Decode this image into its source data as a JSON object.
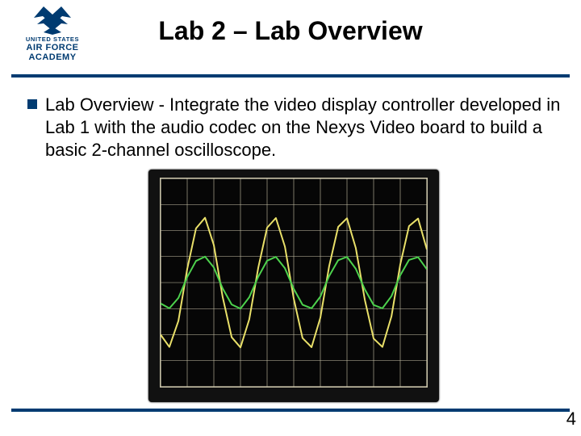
{
  "logo": {
    "line1": "UNITED STATES",
    "line2": "AIR FORCE",
    "line3": "ACADEMY"
  },
  "title": "Lab 2 – Lab Overview",
  "body": {
    "bullet1": "Lab Overview - Integrate the video display controller developed in Lab 1 with the audio codec on the Nexys Video board to build a basic 2-channel oscilloscope."
  },
  "page_number": "4",
  "chart_data": {
    "type": "line",
    "title": "",
    "xlabel": "",
    "ylabel": "",
    "x_divisions": 10,
    "y_divisions": 8,
    "x_range": [
      0,
      10
    ],
    "y_range": [
      -4,
      4
    ],
    "grid": true,
    "legend": false,
    "series": [
      {
        "name": "Channel 1",
        "color": "#e9e069",
        "approx_cycles": 3.0,
        "approx_amplitude_divisions": 2.5,
        "x": [
          0.0,
          0.33,
          0.67,
          1.0,
          1.33,
          1.67,
          2.0,
          2.33,
          2.67,
          3.0,
          3.33,
          3.67,
          4.0,
          4.33,
          4.67,
          5.0,
          5.33,
          5.67,
          6.0,
          6.33,
          6.67,
          7.0,
          7.33,
          7.67,
          8.0,
          8.33,
          8.67,
          9.0,
          9.33,
          9.67,
          10.0
        ],
        "y": [
          -2.0,
          -2.47,
          -1.47,
          0.52,
          2.08,
          2.49,
          1.44,
          -0.55,
          -2.1,
          -2.49,
          -1.41,
          0.58,
          2.11,
          2.48,
          1.38,
          -0.61,
          -2.13,
          -2.48,
          -1.35,
          0.63,
          2.14,
          2.47,
          1.33,
          -0.66,
          -2.15,
          -2.47,
          -1.3,
          0.69,
          2.17,
          2.46,
          1.27
        ]
      },
      {
        "name": "Channel 2",
        "color": "#4dd24d",
        "approx_cycles": 3.0,
        "approx_amplitude_divisions": 1.0,
        "x": [
          0.0,
          0.33,
          0.67,
          1.0,
          1.33,
          1.67,
          2.0,
          2.33,
          2.67,
          3.0,
          3.33,
          3.67,
          4.0,
          4.33,
          4.67,
          5.0,
          5.33,
          5.67,
          6.0,
          6.33,
          6.67,
          7.0,
          7.33,
          7.67,
          8.0,
          8.33,
          8.67,
          9.0,
          9.33,
          9.67,
          10.0
        ],
        "y": [
          -0.8,
          -0.99,
          -0.59,
          0.21,
          0.83,
          1.0,
          0.58,
          -0.22,
          -0.84,
          -1.0,
          -0.56,
          0.23,
          0.84,
          0.99,
          0.55,
          -0.24,
          -0.85,
          -0.99,
          -0.54,
          0.25,
          0.86,
          0.99,
          0.53,
          -0.26,
          -0.86,
          -0.99,
          -0.52,
          0.28,
          0.87,
          0.98,
          0.51
        ]
      }
    ]
  }
}
